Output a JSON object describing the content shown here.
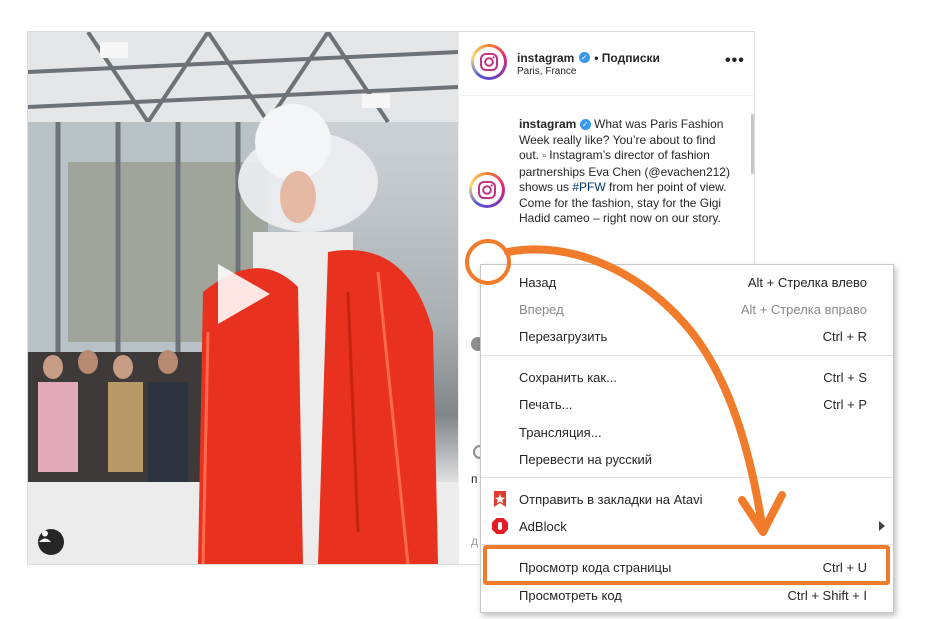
{
  "post": {
    "username": "instagram",
    "follow_label": "• Подписки",
    "location": "Paris, France",
    "more_label": "•••",
    "caption_user": "instagram",
    "caption_text_1": "What was Paris Fashion Week really like? You’re about to find out. ",
    "caption_text_2": " Instagram’s director of fashion partnerships Eva Chen (@evachen212) shows us ",
    "caption_hashtag": "#PFW",
    "caption_text_3": " from her point of view. Come for the fashion, stay for the Gigi Hadid cameo – right now on our story.",
    "frag_1": "п",
    "frag_2": "д"
  },
  "menu": {
    "items": [
      {
        "label": "Назад",
        "shortcut": "Alt + Стрелка влево",
        "enabled": true
      },
      {
        "label": "Вперед",
        "shortcut": "Alt + Стрелка вправо",
        "enabled": false
      },
      {
        "label": "Перезагрузить",
        "shortcut": "Ctrl + R",
        "enabled": true
      },
      {
        "label": "Сохранить как...",
        "shortcut": "Ctrl + S",
        "enabled": true
      },
      {
        "label": "Печать...",
        "shortcut": "Ctrl + P",
        "enabled": true
      },
      {
        "label": "Трансляция...",
        "shortcut": "",
        "enabled": true
      },
      {
        "label": "Перевести на русский",
        "shortcut": "",
        "enabled": true
      },
      {
        "label": "Отправить в закладки на Atavi",
        "shortcut": "",
        "enabled": true
      },
      {
        "label": "AdBlock",
        "shortcut": "",
        "enabled": true
      },
      {
        "label": "Просмотр кода страницы",
        "shortcut": "Ctrl + U",
        "enabled": true
      },
      {
        "label": "Просмотреть код",
        "shortcut": "Ctrl + Shift + I",
        "enabled": true
      }
    ]
  },
  "colors": {
    "annotation": "#f07b2a",
    "verified": "#3897f0",
    "coat": "#e8321f"
  }
}
